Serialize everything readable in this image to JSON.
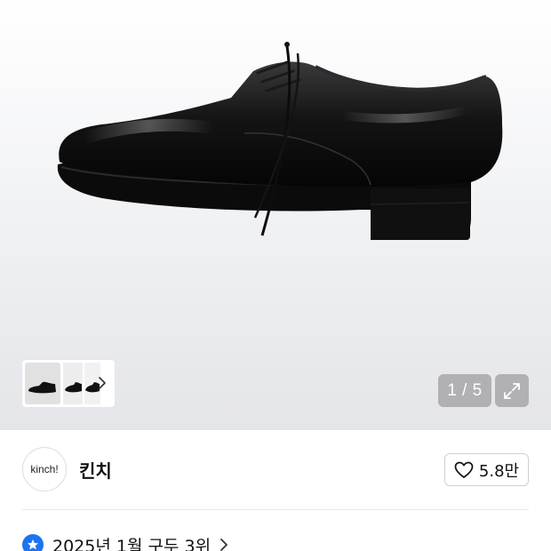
{
  "gallery": {
    "page_current": "1",
    "page_total": "5",
    "page_counter": "1 / 5",
    "main_image": "black-leather-derby-shoe",
    "thumbnails": [
      "shoe-side-view",
      "shoe-pair-view",
      "shoe-detail-view"
    ]
  },
  "brand": {
    "logo_text": "kinch!",
    "name": "킨치",
    "like_count": "5.8만"
  },
  "ranking": {
    "text": "2025년 1월 구두 3위"
  },
  "colors": {
    "accent_blue": "#1e74ef",
    "counter_bg": "#a0a0a5"
  }
}
